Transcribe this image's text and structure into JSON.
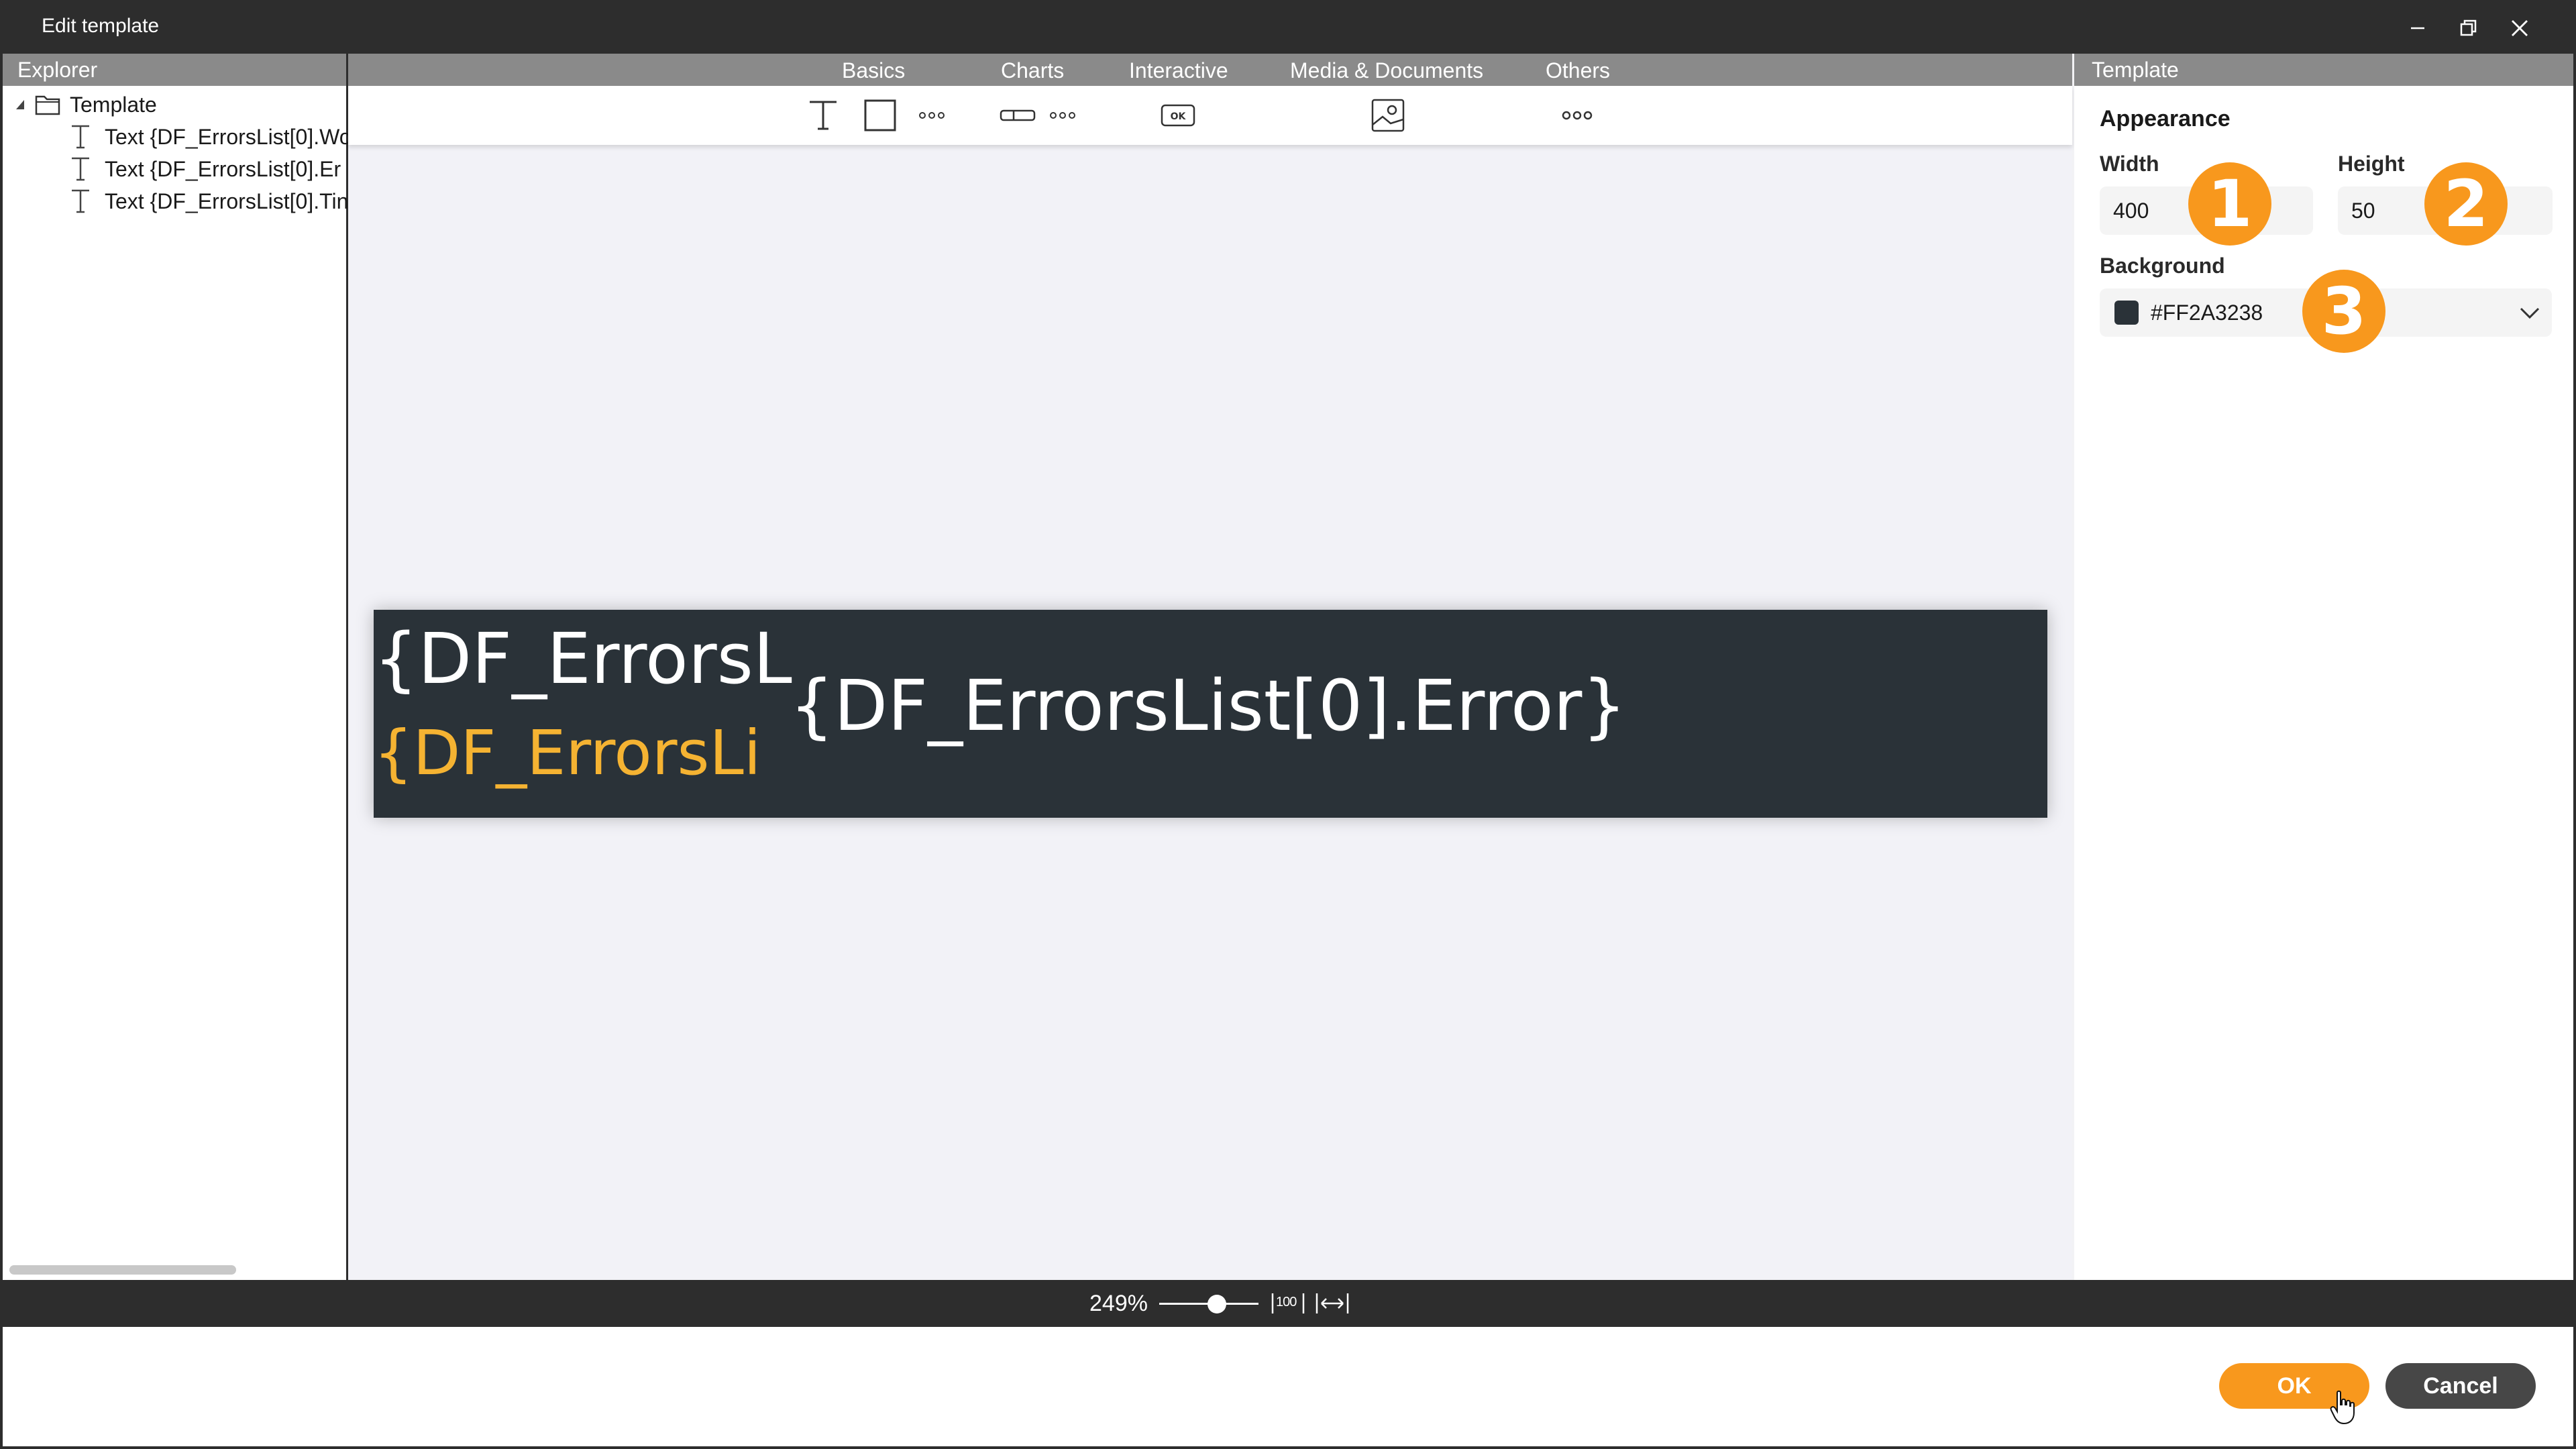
{
  "window": {
    "title": "Edit template"
  },
  "explorer": {
    "header": "Explorer",
    "root": "Template",
    "items": [
      {
        "label": "Text {DF_ErrorsList[0].Wo"
      },
      {
        "label": "Text {DF_ErrorsList[0].Er"
      },
      {
        "label": "Text {DF_ErrorsList[0].Tin"
      }
    ]
  },
  "categories": [
    "Basics",
    "Charts",
    "Interactive",
    "Media & Documents",
    "Others"
  ],
  "toolbar": {
    "tools": [
      "text-tool-icon",
      "rectangle-tool-icon",
      "more-basics-icon",
      "progress-bar-tool-icon",
      "more-charts-icon",
      "ok-button-tool-icon",
      "image-tool-icon",
      "more-others-icon"
    ]
  },
  "canvas": {
    "background": "#2A3238",
    "text_top": "{DF_ErrorsL",
    "text_bottom": "{DF_ErrorsLi",
    "text_main": "{DF_ErrorsList[0].Error}",
    "accent": "#F5B332"
  },
  "properties": {
    "header": "Template",
    "section": "Appearance",
    "width_label": "Width",
    "width_value": "400",
    "height_label": "Height",
    "height_value": "50",
    "background_label": "Background",
    "background_value": "#FF2A3238",
    "badges": [
      "1",
      "2",
      "3"
    ],
    "badge_color": "#F8981D"
  },
  "statusbar": {
    "zoom": "249%",
    "zoom_fit_label": "100"
  },
  "footer": {
    "ok_label": "OK",
    "cancel_label": "Cancel",
    "ok_color": "#F8981D",
    "cancel_color": "#474747"
  }
}
